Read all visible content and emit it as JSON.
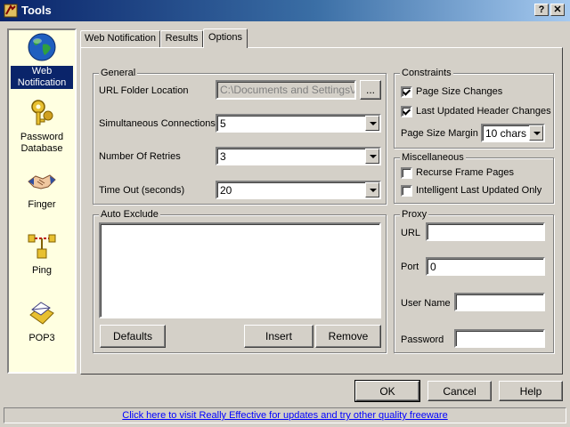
{
  "window": {
    "title": "Tools",
    "help_label": "?",
    "close_label": "✕"
  },
  "sidebar": {
    "items": [
      {
        "label": "Web Notification",
        "icon": "globe-icon",
        "selected": true
      },
      {
        "label": "Password Database",
        "icon": "keys-icon"
      },
      {
        "label": "Finger",
        "icon": "handshake-icon"
      },
      {
        "label": "Ping",
        "icon": "network-icon"
      },
      {
        "label": "POP3",
        "icon": "mail-icon"
      }
    ]
  },
  "tabs": [
    {
      "label": "Web Notification"
    },
    {
      "label": "Results"
    },
    {
      "label": "Options",
      "active": true
    }
  ],
  "general": {
    "title": "General",
    "url_folder_label": "URL Folder Location",
    "url_folder_value": "C:\\Documents and Settings\\Ad",
    "browse_label": "...",
    "connections_label": "Simultaneous Connections",
    "connections_value": "5",
    "retries_label": "Number Of Retries",
    "retries_value": "3",
    "timeout_label": "Time Out (seconds)",
    "timeout_value": "20"
  },
  "auto_exclude": {
    "title": "Auto Exclude",
    "defaults_label": "Defaults",
    "insert_label": "Insert",
    "remove_label": "Remove"
  },
  "constraints": {
    "title": "Constraints",
    "page_size_label": "Page Size Changes",
    "page_size_checked": true,
    "last_updated_label": "Last Updated Header Changes",
    "last_updated_checked": true,
    "margin_label": "Page Size Margin",
    "margin_value": "10 chars"
  },
  "misc": {
    "title": "Miscellaneous",
    "recurse_label": "Recurse Frame Pages",
    "recurse_checked": false,
    "intelligent_label": "Intelligent Last Updated Only",
    "intelligent_checked": false
  },
  "proxy": {
    "title": "Proxy",
    "url_label": "URL",
    "url_value": "",
    "port_label": "Port",
    "port_value": "0",
    "user_label": "User Name",
    "user_value": "",
    "password_label": "Password",
    "password_value": ""
  },
  "footer": {
    "ok_label": "OK",
    "cancel_label": "Cancel",
    "help_label": "Help"
  },
  "status": {
    "link_text": "Click here to visit Really Effective for updates and try other quality freeware"
  }
}
